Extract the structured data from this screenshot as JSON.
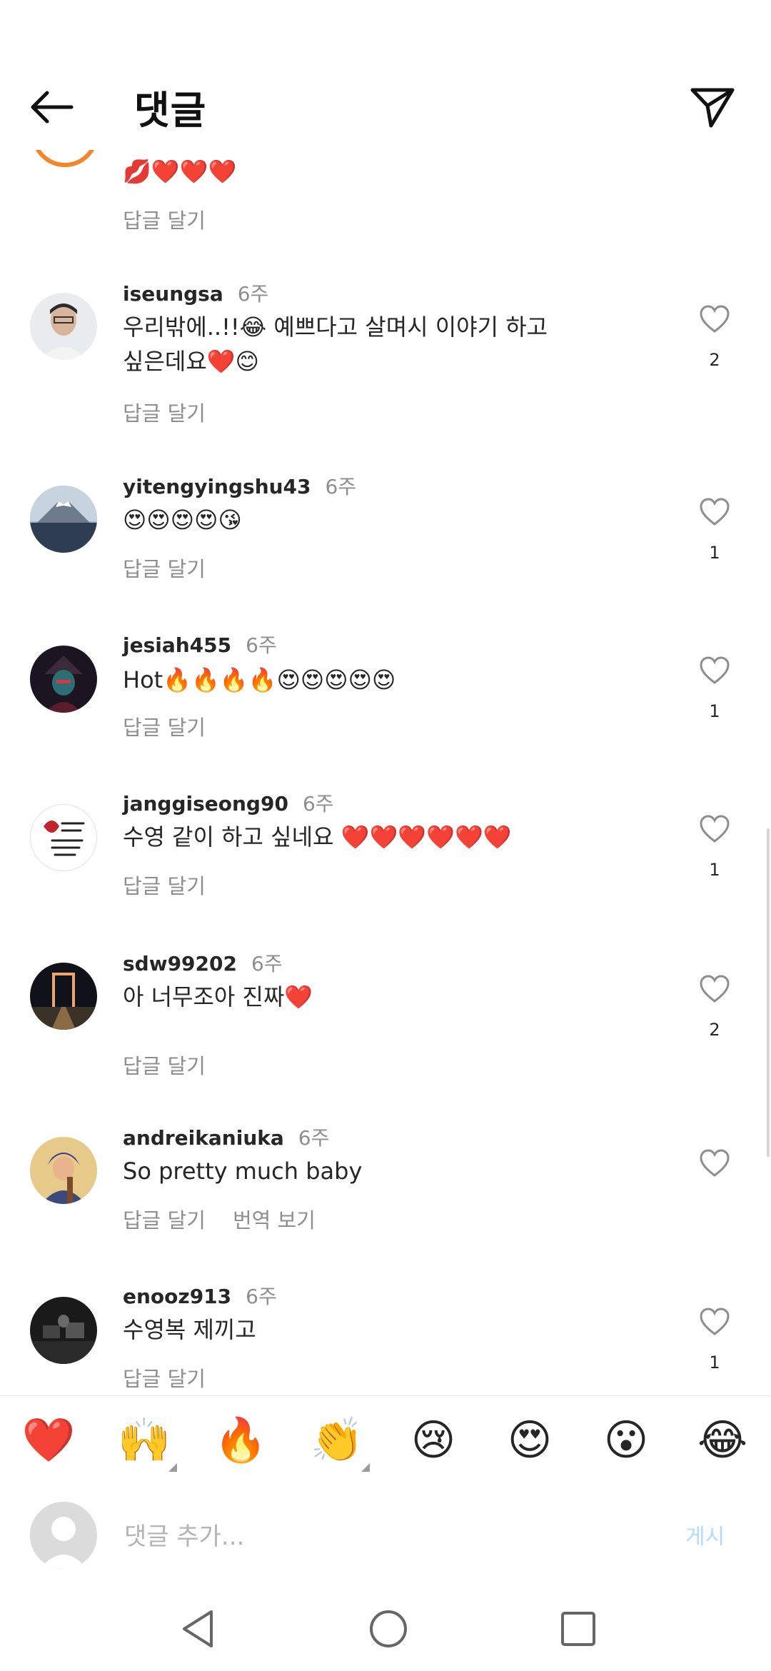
{
  "header": {
    "title": "댓글"
  },
  "partial_comment": {
    "emojis": "💋❤️❤️❤️",
    "reply_label": "답글 달기"
  },
  "comments": [
    {
      "username": "iseungsa",
      "time": "6주",
      "text_line1": "우리밖에..!!😂 예쁘다고 살며시 이야기 하고",
      "text_line2": "싶은데요❤️😊",
      "reply_label": "답글 달기",
      "likes": "2"
    },
    {
      "username": "yitengyingshu43",
      "time": "6주",
      "text": "😍😍😍😍😘",
      "reply_label": "답글 달기",
      "likes": "1"
    },
    {
      "username": "jesiah455",
      "time": "6주",
      "text": "Hot🔥🔥🔥🔥😍😍😍😍😍",
      "reply_label": "답글 달기",
      "likes": "1"
    },
    {
      "username": "janggiseong90",
      "time": "6주",
      "text": "수영 같이 하고 싶네요 ❤️❤️❤️❤️❤️❤️",
      "reply_label": "답글 달기",
      "likes": "1"
    },
    {
      "username": "sdw99202",
      "time": "6주",
      "text": "아 너무조아 진짜❤️",
      "reply_label": "답글 달기",
      "likes": "2"
    },
    {
      "username": "andreikaniuka",
      "time": "6주",
      "text": "So pretty much baby",
      "reply_label": "답글 달기",
      "translate_label": "번역 보기",
      "likes": ""
    },
    {
      "username": "enooz913",
      "time": "6주",
      "text": "수영복 제끼고",
      "reply_label": "답글 달기",
      "likes": "1"
    }
  ],
  "emoji_bar": [
    "❤️",
    "🙌",
    "🔥",
    "👏",
    "😢",
    "😍",
    "😮",
    "😂"
  ],
  "input": {
    "placeholder": "댓글 추가...",
    "post_label": "게시"
  },
  "colors": {
    "accent_disabled": "#b3dbff",
    "secondary_text": "#8e8e8e",
    "primary_text": "#262626"
  }
}
